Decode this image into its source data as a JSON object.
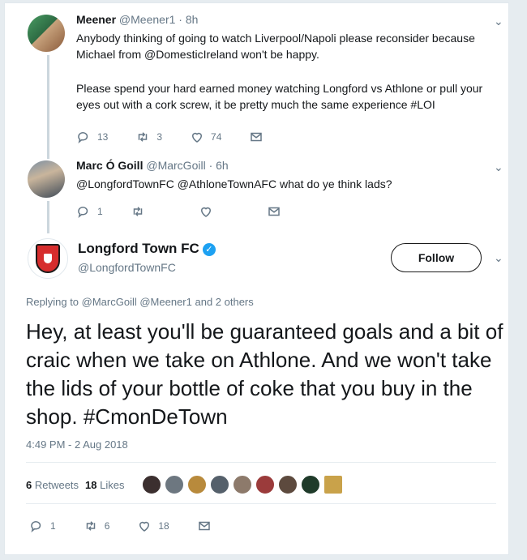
{
  "tweets": [
    {
      "name": "Meener",
      "handle": "@Meener1",
      "time": "· 8h",
      "text1": "Anybody thinking of going to watch Liverpool/Napoli please reconsider because Michael from  @DomesticIreland won't be happy.",
      "text2": "Please spend your hard earned money watching Longford vs Athlone  or pull your eyes out with a cork screw, it be pretty much the same experience #LOI",
      "replies": "13",
      "retweets": "3",
      "likes": "74"
    },
    {
      "name": "Marc Ó Goill",
      "handle": "@MarcGoill",
      "time": "· 6h",
      "text1": "@LongfordTownFC  @AthloneTownAFC  what do ye think lads?",
      "replies": "1",
      "retweets": "",
      "likes": ""
    }
  ],
  "main": {
    "name": "Longford Town FC",
    "handle": "@LongfordTownFC",
    "follow_label": "Follow",
    "replying_prefix": "Replying to ",
    "replying_users": "@MarcGoill @Meener1",
    "replying_suffix": " and 2 others",
    "text": "Hey, at least you'll be guaranteed goals and a bit of craic when we take on Athlone. And we won't take the lids of your bottle of coke that you buy in the shop. #CmonDeTown",
    "timestamp": "4:49 PM - 2 Aug 2018",
    "retweet_count": "6",
    "retweet_label": " Retweets",
    "like_count": "18",
    "like_label": " Likes",
    "replies": "1",
    "retweets": "6",
    "likes": "18"
  },
  "colors": {
    "accent": "#1da1f2",
    "muted": "#657786",
    "text": "#14171a",
    "border": "#e1e8ed"
  },
  "icons": [
    "reply-icon",
    "retweet-icon",
    "like-icon",
    "dm-icon",
    "chevron-down-icon",
    "verified-icon"
  ]
}
